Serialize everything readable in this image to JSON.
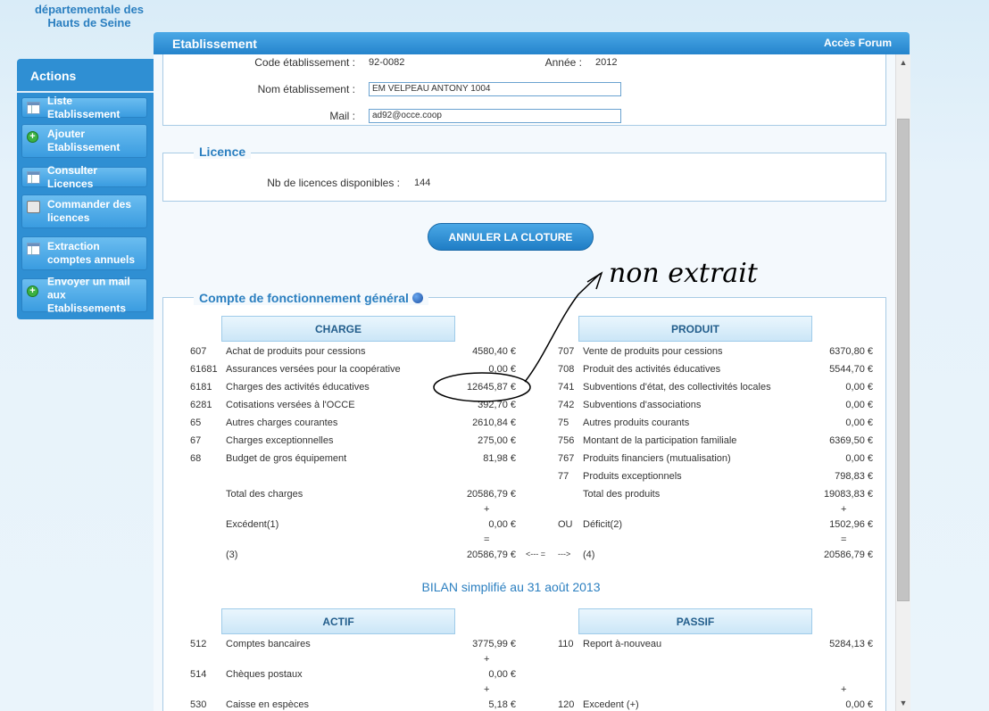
{
  "org_name": "départementale des Hauts de Seine",
  "sidebar": {
    "title": "Actions",
    "items": [
      {
        "label": "Liste Etablissement",
        "icon": "table-icon"
      },
      {
        "label": "Ajouter Etablissement",
        "icon": "add-icon"
      },
      {
        "label": "Consulter Licences",
        "icon": "table-icon"
      },
      {
        "label": "Commander des licences",
        "icon": "printer-icon"
      },
      {
        "label": "Extraction comptes annuels",
        "icon": "table-icon"
      },
      {
        "label": "Envoyer un mail aux Etablissements",
        "icon": "add-icon"
      }
    ]
  },
  "header": {
    "title": "Etablissement",
    "forum_link": "Accès Forum"
  },
  "etablissement": {
    "code_label": "Code établissement :",
    "code_value": "92-0082",
    "annee_label": "Année :",
    "annee_value": "2012",
    "nom_label": "Nom établissement :",
    "nom_value": "EM VELPEAU ANTONY 1004",
    "mail_label": "Mail :",
    "mail_value": "ad92@occe.coop"
  },
  "licence": {
    "legend": "Licence",
    "label": "Nb de licences disponibles :",
    "value": "144"
  },
  "cloture_button": "ANNULER LA CLOTURE",
  "annotation_text": "non extrait",
  "compte": {
    "legend": "Compte de fonctionnement général",
    "charge_header": "CHARGE",
    "produit_header": "PRODUIT",
    "charges": [
      {
        "code": "607",
        "label": "Achat de produits pour cessions",
        "amount": "4580,40 €"
      },
      {
        "code": "61681",
        "label": "Assurances versées pour la coopérative",
        "amount": "0,00 €"
      },
      {
        "code": "6181",
        "label": "Charges des activités éducatives",
        "amount": "12645,87 €"
      },
      {
        "code": "6281",
        "label": "Cotisations versées à l'OCCE",
        "amount": "392,70 €"
      },
      {
        "code": "65",
        "label": "Autres charges courantes",
        "amount": "2610,84 €"
      },
      {
        "code": "67",
        "label": "Charges exceptionnelles",
        "amount": "275,00 €"
      },
      {
        "code": "68",
        "label": "Budget de gros équipement",
        "amount": "81,98 €"
      }
    ],
    "produits": [
      {
        "code": "707",
        "label": "Vente de produits pour cessions",
        "amount": "6370,80 €"
      },
      {
        "code": "708",
        "label": "Produit des activités éducatives",
        "amount": "5544,70 €"
      },
      {
        "code": "741",
        "label": "Subventions d'état, des collectivités locales",
        "amount": "0,00 €"
      },
      {
        "code": "742",
        "label": "Subventions d'associations",
        "amount": "0,00 €"
      },
      {
        "code": "75",
        "label": "Autres produits courants",
        "amount": "0,00 €"
      },
      {
        "code": "756",
        "label": "Montant de la participation familiale",
        "amount": "6369,50 €"
      },
      {
        "code": "767",
        "label": "Produits financiers (mutualisation)",
        "amount": "0,00 €"
      },
      {
        "code": "77",
        "label": "Produits exceptionnels",
        "amount": "798,83 €"
      }
    ],
    "total_charges_label": "Total des charges",
    "total_charges": "20586,79 €",
    "total_produits_label": "Total des produits",
    "total_produits": "19083,83 €",
    "plus": "+",
    "equals": "=",
    "excedent_label": "Excédent(1)",
    "excedent": "0,00 €",
    "ou": "OU",
    "deficit_label": "Déficit(2)",
    "deficit": "1502,96 €",
    "row3_label": "(3)",
    "row3": "20586,79 €",
    "arrow_left": "<--- =",
    "arrow_right": "--->",
    "row4_label": "(4)",
    "row4": "20586,79 €"
  },
  "bilan": {
    "title": "BILAN simplifié au 31 août 2013",
    "actif_header": "ACTIF",
    "passif_header": "PASSIF",
    "actif": [
      {
        "code": "512",
        "label": "Comptes bancaires",
        "amount": "3775,99 €"
      },
      {
        "code": "514",
        "label": "Chèques postaux",
        "amount": "0,00 €"
      },
      {
        "code": "530",
        "label": "Caisse en espèces",
        "amount": "5,18 €"
      }
    ],
    "passif": [
      {
        "code": "110",
        "label": "Report à-nouveau",
        "amount": "5284,13 €"
      },
      {
        "code": "120",
        "label": "Excedent (+)",
        "amount": "0,00 €"
      }
    ]
  }
}
